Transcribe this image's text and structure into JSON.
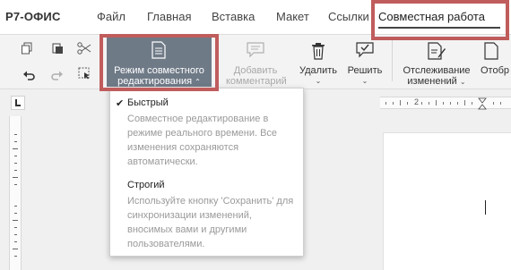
{
  "app": {
    "logo": "Р7-ОФИС"
  },
  "menu": {
    "tabs": [
      {
        "label": "Файл"
      },
      {
        "label": "Главная"
      },
      {
        "label": "Вставка"
      },
      {
        "label": "Макет"
      },
      {
        "label": "Ссылки"
      }
    ],
    "active_tab": "Совместная работа"
  },
  "toolbar": {
    "collab_mode": {
      "line1": "Режим совместного",
      "line2": "редактирования"
    },
    "add_comment": {
      "line1": "Добавить",
      "line2": "комментарий"
    },
    "delete": {
      "label": "Удалить"
    },
    "resolve": {
      "label": "Решить"
    },
    "track_changes": {
      "line1": "Отслеживание",
      "line2": "изменений"
    },
    "display": {
      "label": "Отобр"
    }
  },
  "ruler": {
    "mark": "2"
  },
  "dropdown": {
    "fast": {
      "title": "Быстрый",
      "checked": true,
      "description": "Совместное редактирование в режиме реального времени. Все изменения сохраняются автоматически."
    },
    "strict": {
      "title": "Строгий",
      "description": "Используйте кнопку 'Сохранить' для синхронизации изменений, вносимых вами и другими пользователями."
    }
  },
  "colors": {
    "highlight": "#c05c5c",
    "active_button": "#6f7a87"
  }
}
